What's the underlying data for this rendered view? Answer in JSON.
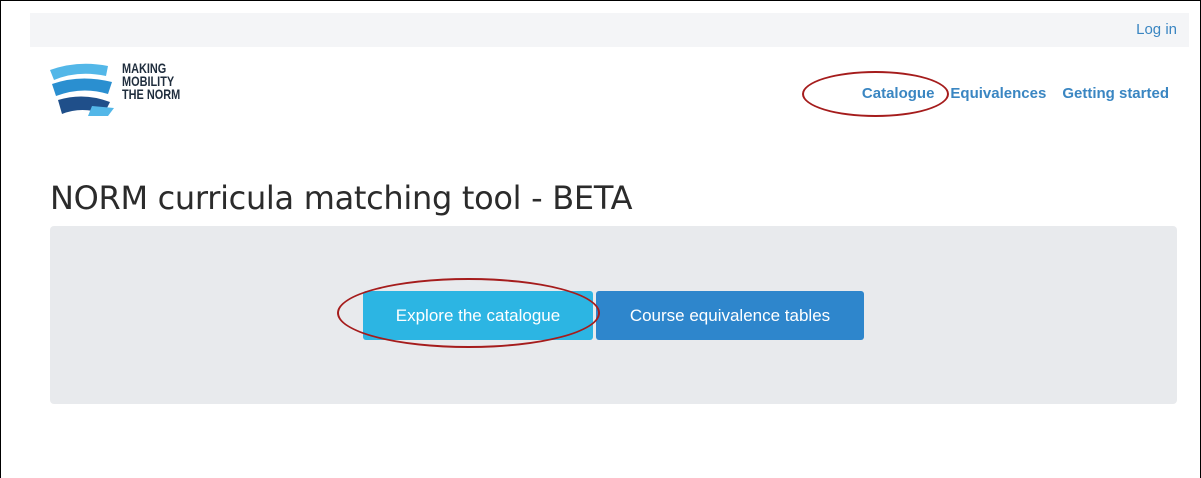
{
  "topbar": {
    "login_label": "Log in"
  },
  "logo": {
    "line1": "MAKING",
    "line2": "MOBILITY",
    "line3": "THE NORM",
    "colors": {
      "primary": "#2a8fd0",
      "secondary": "#1f4f8a",
      "accent": "#53b7e8"
    }
  },
  "nav": {
    "items": [
      {
        "label": "Catalogue"
      },
      {
        "label": "Equivalences"
      },
      {
        "label": "Getting started"
      }
    ]
  },
  "main": {
    "title": "NORM curricula matching tool - BETA",
    "buttons": {
      "explore_label": "Explore the catalogue",
      "equivalence_label": "Course equivalence tables"
    }
  },
  "colors": {
    "link": "#3a86c2",
    "explore_button": "#2cb5e3",
    "equivalence_button": "#2e86cc",
    "hero_background": "#e8eaed",
    "annotation": "#a51c1c"
  }
}
